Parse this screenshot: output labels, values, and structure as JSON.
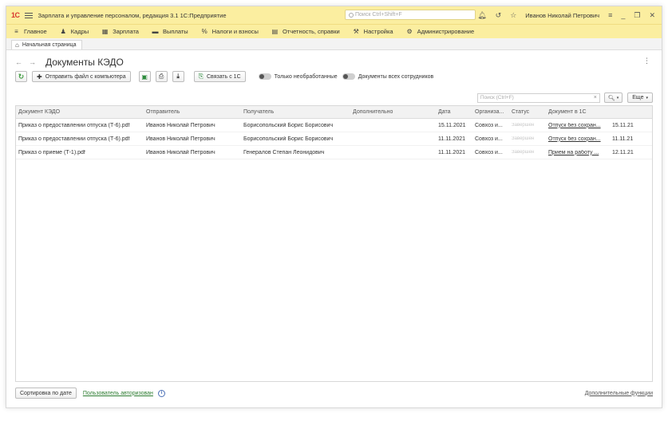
{
  "titlebar": {
    "logo": "1С",
    "app_title": "Зарплата и управление персоналом, редакция 3.1 1С:Предприятие",
    "search_placeholder": "Поиск Ctrl+Shift+F",
    "user_name": "Иванов Николай Петрович"
  },
  "menu": {
    "items": [
      {
        "label": "Главное",
        "icon": "menu-icon"
      },
      {
        "label": "Кадры",
        "icon": "people-icon"
      },
      {
        "label": "Зарплата",
        "icon": "calculator-icon"
      },
      {
        "label": "Выплаты",
        "icon": "money-icon"
      },
      {
        "label": "Налоги и взносы",
        "icon": "percent-icon"
      },
      {
        "label": "Отчетность, справки",
        "icon": "report-icon"
      },
      {
        "label": "Настройка",
        "icon": "wrench-icon"
      },
      {
        "label": "Администрирование",
        "icon": "gear-icon"
      }
    ]
  },
  "tabs": {
    "home_label": "Начальная страница"
  },
  "form": {
    "title": "Документы КЭДО"
  },
  "toolbar": {
    "send_file_label": "Отправить файл с компьютера",
    "link_1c_label": "Связать с 1С",
    "only_unprocessed_label": "Только необработанные",
    "all_employees_label": "Документы всех сотрудников"
  },
  "search": {
    "placeholder": "Поиск (Ctrl+F)",
    "more_label": "Еще"
  },
  "table": {
    "columns": [
      "Документ КЭДО",
      "Отправитель",
      "Получатель",
      "Дополнительно",
      "Дата",
      "Организа...",
      "Статус",
      "Документ в 1С",
      ""
    ],
    "rows": [
      {
        "doc": "Приказ о предоставлении отпуска (Т-6).pdf",
        "sender": "Иванов Николай Петрович",
        "recipient": "Борисопольский Борис Борисович",
        "extra": "",
        "date": "15.11.2021",
        "org": "Совхоз и...",
        "status": "Завершен",
        "doc1c": "Отпуск без сохран...",
        "date1c": "15.11.21"
      },
      {
        "doc": "Приказ о предоставлении отпуска (Т-6).pdf",
        "sender": "Иванов Николай Петрович",
        "recipient": "Борисопольский Борис Борисович",
        "extra": "",
        "date": "11.11.2021",
        "org": "Совхоз и...",
        "status": "Завершен",
        "doc1c": "Отпуск без сохран...",
        "date1c": "11.11.21"
      },
      {
        "doc": "Приказ о приеме (Т-1).pdf",
        "sender": "Иванов Николай Петрович",
        "recipient": "Генералов Степан Леонидович",
        "extra": "",
        "date": "11.11.2021",
        "org": "Совхоз и...",
        "status": "Завершен",
        "doc1c": "Прием на работу ...",
        "date1c": "12.11.21"
      }
    ]
  },
  "footer": {
    "sort_label": "Сортировка по дате",
    "auth_label": "Пользователь авторизован",
    "extra_label": "Дополнительные функции"
  },
  "colors": {
    "accent_yellow": "#fbeea0",
    "logo_red": "#d8362e",
    "auth_green": "#2e7d32"
  }
}
